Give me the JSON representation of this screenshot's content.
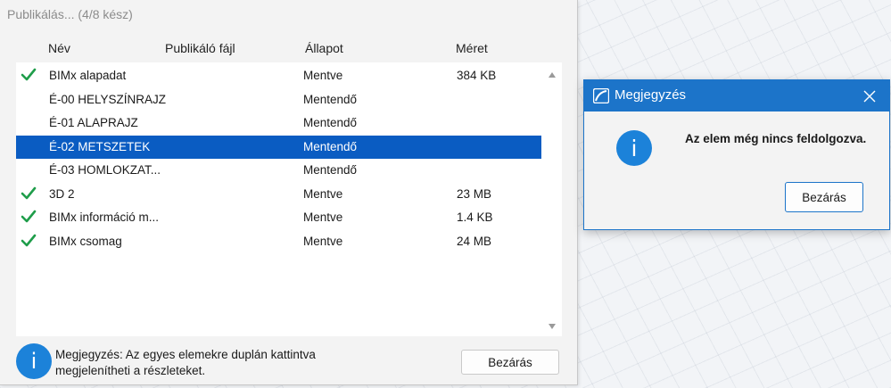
{
  "main_window": {
    "title": "Publikálás... (4/8 kész)",
    "columns": {
      "name": "Név",
      "file": "Publikáló fájl",
      "status": "Állapot",
      "size": "Méret"
    },
    "rows": [
      {
        "name": "BIMx alapadat",
        "file": "",
        "status": "Mentve",
        "size": "384 KB",
        "checked": true,
        "selected": false
      },
      {
        "name": "É-00 HELYSZÍNRAJZ",
        "file": "",
        "status": "Mentendő",
        "size": "",
        "checked": false,
        "selected": false
      },
      {
        "name": "É-01 ALAPRAJZ",
        "file": "",
        "status": "Mentendő",
        "size": "",
        "checked": false,
        "selected": false
      },
      {
        "name": "É-02 METSZETEK",
        "file": "",
        "status": "Mentendő",
        "size": "",
        "checked": false,
        "selected": true
      },
      {
        "name": "É-03 HOMLOKZAT...",
        "file": "",
        "status": "Mentendő",
        "size": "",
        "checked": false,
        "selected": false
      },
      {
        "name": "3D 2",
        "file": "",
        "status": "Mentve",
        "size": "23 MB",
        "checked": true,
        "selected": false
      },
      {
        "name": "BIMx információ m...",
        "file": "",
        "status": "Mentve",
        "size": "1.4 KB",
        "checked": true,
        "selected": false
      },
      {
        "name": "BIMx csomag",
        "file": "",
        "status": "Mentve",
        "size": "24 MB",
        "checked": true,
        "selected": false
      }
    ],
    "note_icon": "i",
    "note_line1": "Megjegyzés: Az egyes elemekre duplán kattintva",
    "note_line2": "megjelenítheti a részleteket.",
    "close_label": "Bezárás"
  },
  "dialog": {
    "title": "Megjegyzés",
    "message": "Az elem még nincs feldolgozva.",
    "info_icon": "i",
    "close_label": "Bezárás"
  },
  "colors": {
    "selection": "#0a5cc2",
    "check": "#1f9d4a",
    "titlebar": "#1c74c9",
    "info_icon": "#1c82d9"
  },
  "icons": {
    "check": "check-icon",
    "info": "info-icon",
    "close": "close-icon",
    "app": "app-logo-icon",
    "scroll_up": "scroll-up-arrow-icon",
    "scroll_down": "scroll-down-arrow-icon"
  }
}
